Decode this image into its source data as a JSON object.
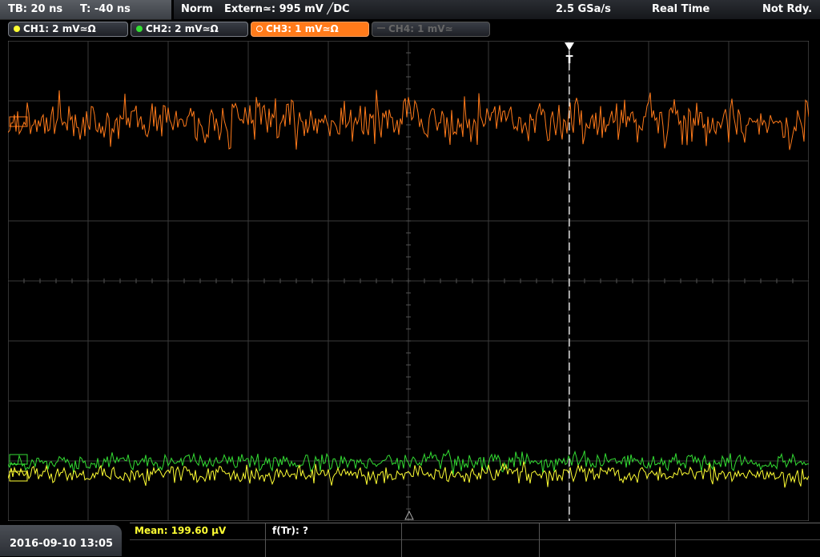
{
  "header": {
    "timebase": "TB: 20 ns",
    "trigger_time": "T: -40 ns",
    "trigger_mode": "Norm",
    "trigger_source": "Extern≃: 995 mV ╱DC",
    "sample_rate": "2.5 GSa/s",
    "acq_mode": "Real Time",
    "status": "Not Rdy."
  },
  "channels": [
    {
      "label": "CH1: 2 mV≃Ω",
      "color": "#ffff33",
      "state": "on"
    },
    {
      "label": "CH2: 2 mV≃Ω",
      "color": "#33dd33",
      "state": "on"
    },
    {
      "label": "CH3: 1 mV≃Ω",
      "color": "#ff7a1a",
      "state": "active"
    },
    {
      "label": "CH4: 1 mV≃",
      "color": "#666666",
      "state": "off"
    }
  ],
  "colors": {
    "grid": "#3a3a3a",
    "ch1": "#ffff33",
    "ch2": "#33dd33",
    "ch3": "#ff7a1a",
    "trigger_marker": "#ffffff"
  },
  "footer": {
    "datetime": "2016-09-10 13:05",
    "mean": "Mean: 199.60 µV",
    "freq": "f(Tr): ?"
  }
}
